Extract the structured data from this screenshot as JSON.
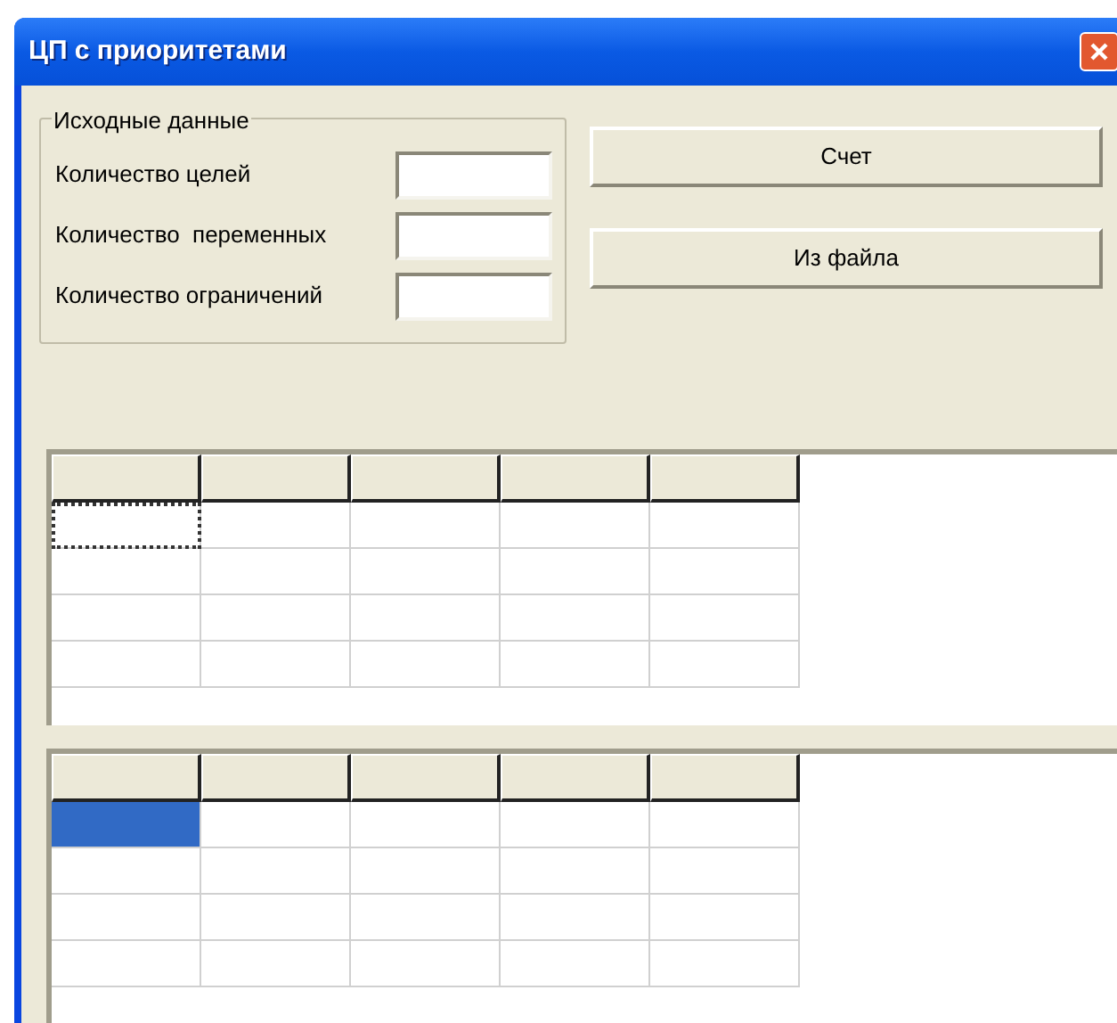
{
  "window": {
    "title": "ЦП с приоритетами"
  },
  "input_group": {
    "title": "Исходные данные",
    "fields": [
      {
        "label": "Количество целей"
      },
      {
        "label": "Количество  переменных"
      },
      {
        "label": "Количество ограничений"
      }
    ]
  },
  "buttons": [
    "Счет",
    "Из файла"
  ],
  "grids": [
    {
      "rows": [
        {
          "cells": [
            {
              "focused": true,
              "selected": false
            },
            {
              "focused": false,
              "selected": false
            },
            {
              "focused": false,
              "selected": false
            },
            {
              "focused": false,
              "selected": false
            },
            {
              "focused": false,
              "selected": false
            }
          ]
        },
        {
          "cells": [
            {
              "focused": false,
              "selected": false
            },
            {
              "focused": false,
              "selected": false
            },
            {
              "focused": false,
              "selected": false
            },
            {
              "focused": false,
              "selected": false
            },
            {
              "focused": false,
              "selected": false
            }
          ]
        },
        {
          "cells": [
            {
              "focused": false,
              "selected": false
            },
            {
              "focused": false,
              "selected": false
            },
            {
              "focused": false,
              "selected": false
            },
            {
              "focused": false,
              "selected": false
            },
            {
              "focused": false,
              "selected": false
            }
          ]
        },
        {
          "cells": [
            {
              "focused": false,
              "selected": false
            },
            {
              "focused": false,
              "selected": false
            },
            {
              "focused": false,
              "selected": false
            },
            {
              "focused": false,
              "selected": false
            },
            {
              "focused": false,
              "selected": false
            }
          ]
        }
      ]
    },
    {
      "rows": [
        {
          "cells": [
            {
              "focused": false,
              "selected": true
            },
            {
              "focused": false,
              "selected": false
            },
            {
              "focused": false,
              "selected": false
            },
            {
              "focused": false,
              "selected": false
            },
            {
              "focused": false,
              "selected": false
            }
          ]
        },
        {
          "cells": [
            {
              "focused": false,
              "selected": false
            },
            {
              "focused": false,
              "selected": false
            },
            {
              "focused": false,
              "selected": false
            },
            {
              "focused": false,
              "selected": false
            },
            {
              "focused": false,
              "selected": false
            }
          ]
        },
        {
          "cells": [
            {
              "focused": false,
              "selected": false
            },
            {
              "focused": false,
              "selected": false
            },
            {
              "focused": false,
              "selected": false
            },
            {
              "focused": false,
              "selected": false
            },
            {
              "focused": false,
              "selected": false
            }
          ]
        },
        {
          "cells": [
            {
              "focused": false,
              "selected": false
            },
            {
              "focused": false,
              "selected": false
            },
            {
              "focused": false,
              "selected": false
            },
            {
              "focused": false,
              "selected": false
            },
            {
              "focused": false,
              "selected": false
            }
          ]
        }
      ]
    }
  ]
}
